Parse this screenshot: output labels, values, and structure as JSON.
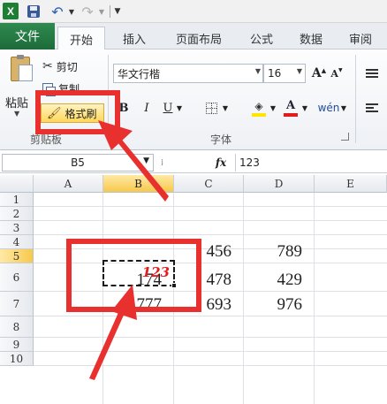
{
  "app": {
    "logo": "X"
  },
  "tabs": {
    "file": "文件",
    "home": "开始",
    "insert": "插入",
    "page_layout": "页面布局",
    "formulas": "公式",
    "data": "数据",
    "review": "审阅"
  },
  "clipboard": {
    "paste_label": "粘贴",
    "cut_label": "剪切",
    "copy_label": "复制",
    "format_painter_label": "格式刷",
    "group_label": "剪贴板"
  },
  "font": {
    "name": "华文行楷",
    "size": "16",
    "grow": "A",
    "shrink": "A",
    "bold": "B",
    "italic": "I",
    "underline": "U",
    "font_color_letter": "A",
    "phonetic": "wén",
    "group_label": "字体",
    "fill_color": "#ffe600",
    "text_color": "#e21b1b"
  },
  "formula_bar": {
    "name_box": "B5",
    "fx": "fx",
    "value": "123"
  },
  "grid": {
    "columns": [
      "A",
      "B",
      "C",
      "D",
      "E"
    ],
    "active_column": "B",
    "rows": [
      "1",
      "2",
      "3",
      "4",
      "5",
      "6",
      "7",
      "8",
      "9",
      "10"
    ],
    "active_row": "5",
    "cells": {
      "B5": "123",
      "C5": "456",
      "D5": "789",
      "B6": "174",
      "C6": "478",
      "D6": "429",
      "B7": "777",
      "C7": "693",
      "D7": "976"
    }
  },
  "annotation_color": "#e8302f"
}
